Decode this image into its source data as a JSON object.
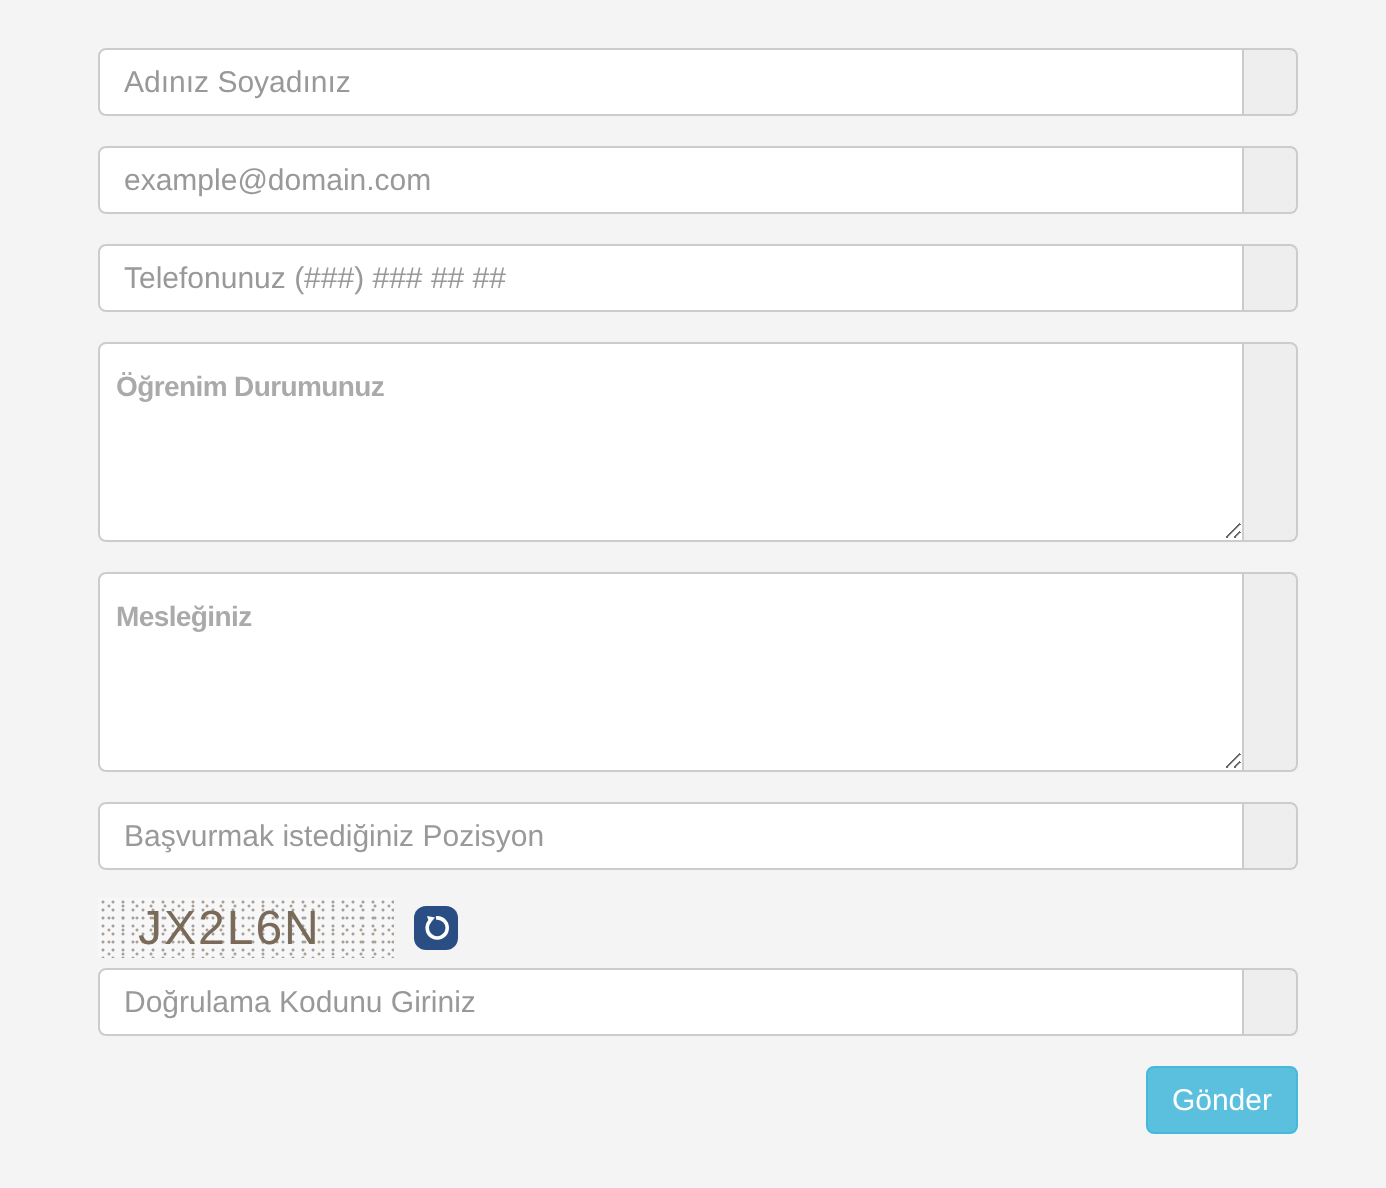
{
  "fields": [
    {
      "kind": "input",
      "placeholder": "Adınız Soyadınız"
    },
    {
      "kind": "input",
      "placeholder": "example@domain.com"
    },
    {
      "kind": "input",
      "placeholder": "Telefonunuz (###) ### ## ##"
    },
    {
      "kind": "textarea",
      "placeholder": "Öğrenim Durumunuz"
    },
    {
      "kind": "textarea",
      "placeholder": "Mesleğiniz"
    },
    {
      "kind": "input",
      "placeholder": "Başvurmak istediğiniz Pozisyon"
    }
  ],
  "captcha": {
    "code": "JX2L6N"
  },
  "verification": {
    "kind": "input",
    "placeholder": "Doğrulama Kodunu Giriniz"
  },
  "submit_button": "Gönder"
}
